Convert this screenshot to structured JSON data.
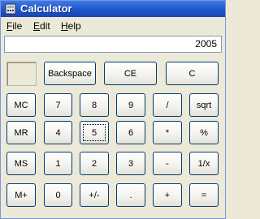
{
  "window": {
    "title": "Calculator",
    "titlebar_color": "#1F52C9"
  },
  "menu": {
    "file": {
      "accel": "F",
      "rest": "ile"
    },
    "edit": {
      "accel": "E",
      "rest": "dit"
    },
    "help": {
      "accel": "H",
      "rest": "elp"
    }
  },
  "display": {
    "value": "2005"
  },
  "buttons": {
    "backspace": "Backspace",
    "ce": "CE",
    "c": "C",
    "mc": "MC",
    "mr": "MR",
    "ms": "MS",
    "mplus": "M+",
    "d7": "7",
    "d8": "8",
    "d9": "9",
    "d4": "4",
    "d5": "5",
    "d6": "6",
    "d1": "1",
    "d2": "2",
    "d3": "3",
    "d0": "0",
    "divide": "/",
    "multiply": "*",
    "minus": "-",
    "plus": "+",
    "sqrt": "sqrt",
    "percent": "%",
    "reciprocal": "1/x",
    "equals": "=",
    "sign": "+/-",
    "decimal": "."
  }
}
